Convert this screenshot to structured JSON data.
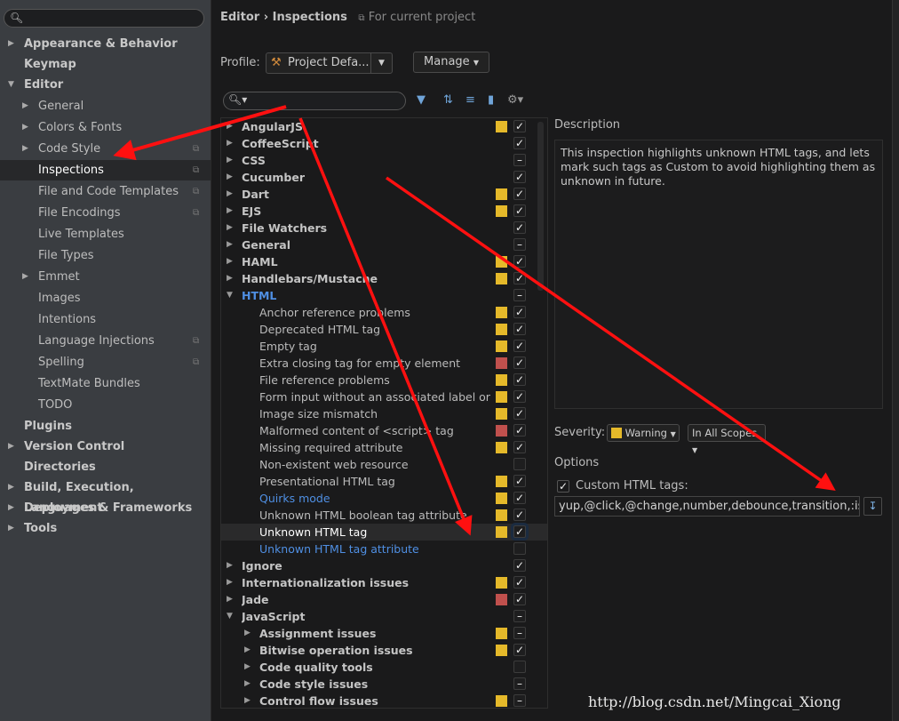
{
  "colors": {
    "warning": "#e5b92a",
    "error": "#c0504d",
    "link": "#4f8fe3",
    "accent": "#6fa4d8",
    "arrow": "#ff1010"
  },
  "sidebar": {
    "search_placeholder": "",
    "items": [
      {
        "label": "Appearance & Behavior",
        "level": 0,
        "arrow": "right"
      },
      {
        "label": "Keymap",
        "level": 0
      },
      {
        "label": "Editor",
        "level": 0,
        "arrow": "down"
      },
      {
        "label": "General",
        "level": 1,
        "arrow": "right"
      },
      {
        "label": "Colors & Fonts",
        "level": 1,
        "arrow": "right"
      },
      {
        "label": "Code Style",
        "level": 1,
        "arrow": "right",
        "copy": true
      },
      {
        "label": "Inspections",
        "level": 1,
        "selected": true,
        "copy": true
      },
      {
        "label": "File and Code Templates",
        "level": 1,
        "copy": true
      },
      {
        "label": "File Encodings",
        "level": 1,
        "copy": true
      },
      {
        "label": "Live Templates",
        "level": 1
      },
      {
        "label": "File Types",
        "level": 1
      },
      {
        "label": "Emmet",
        "level": 1,
        "arrow": "right"
      },
      {
        "label": "Images",
        "level": 1
      },
      {
        "label": "Intentions",
        "level": 1
      },
      {
        "label": "Language Injections",
        "level": 1,
        "copy": true
      },
      {
        "label": "Spelling",
        "level": 1,
        "copy": true
      },
      {
        "label": "TextMate Bundles",
        "level": 1
      },
      {
        "label": "TODO",
        "level": 1
      },
      {
        "label": "Plugins",
        "level": 0
      },
      {
        "label": "Version Control",
        "level": 0,
        "arrow": "right"
      },
      {
        "label": "Directories",
        "level": 0
      },
      {
        "label": "Build, Execution, Deployment",
        "level": 0,
        "arrow": "right"
      },
      {
        "label": "Languages & Frameworks",
        "level": 0,
        "arrow": "right"
      },
      {
        "label": "Tools",
        "level": 0,
        "arrow": "right"
      }
    ]
  },
  "header": {
    "crumb_parent": "Editor",
    "crumb_sep": "›",
    "crumb_current": "Inspections",
    "scope": "For current project"
  },
  "profile": {
    "label": "Profile:",
    "value": "Project Defa...",
    "manage": "Manage"
  },
  "tree": {
    "rows": [
      {
        "label": "AngularJS",
        "level": 0,
        "group": true,
        "arrow": "right",
        "sev": "warning",
        "check": "checked"
      },
      {
        "label": "CoffeeScript",
        "level": 0,
        "group": true,
        "arrow": "right",
        "sev": null,
        "check": "checked"
      },
      {
        "label": "CSS",
        "level": 0,
        "group": true,
        "arrow": "right",
        "sev": null,
        "check": "partial"
      },
      {
        "label": "Cucumber",
        "level": 0,
        "group": true,
        "arrow": "right",
        "sev": null,
        "check": "checked"
      },
      {
        "label": "Dart",
        "level": 0,
        "group": true,
        "arrow": "right",
        "sev": "warning",
        "check": "checked"
      },
      {
        "label": "EJS",
        "level": 0,
        "group": true,
        "arrow": "right",
        "sev": "warning",
        "check": "checked"
      },
      {
        "label": "File Watchers",
        "level": 0,
        "group": true,
        "arrow": "right",
        "sev": null,
        "check": "checked"
      },
      {
        "label": "General",
        "level": 0,
        "group": true,
        "arrow": "right",
        "sev": null,
        "check": "partial"
      },
      {
        "label": "HAML",
        "level": 0,
        "group": true,
        "arrow": "right",
        "sev": "warning",
        "check": "checked"
      },
      {
        "label": "Handlebars/Mustache",
        "level": 0,
        "group": true,
        "arrow": "right",
        "sev": "warning",
        "check": "checked"
      },
      {
        "label": "HTML",
        "level": 0,
        "group": true,
        "arrow": "down",
        "sev": null,
        "check": "partial",
        "blue": true
      },
      {
        "label": "Anchor reference problems",
        "level": 1,
        "sev": "warning",
        "check": "checked"
      },
      {
        "label": "Deprecated HTML tag",
        "level": 1,
        "sev": "warning",
        "check": "checked"
      },
      {
        "label": "Empty tag",
        "level": 1,
        "sev": "warning",
        "check": "checked"
      },
      {
        "label": "Extra closing tag for empty element",
        "level": 1,
        "sev": "error",
        "check": "checked"
      },
      {
        "label": "File reference problems",
        "level": 1,
        "sev": "warning",
        "check": "checked"
      },
      {
        "label": "Form input without an associated label or title",
        "level": 1,
        "sev": "warning",
        "check": "checked"
      },
      {
        "label": "Image size mismatch",
        "level": 1,
        "sev": "warning",
        "check": "checked"
      },
      {
        "label": "Malformed content of <script> tag",
        "level": 1,
        "sev": "error",
        "check": "checked"
      },
      {
        "label": "Missing required attribute",
        "level": 1,
        "sev": "warning",
        "check": "checked"
      },
      {
        "label": "Non-existent web resource",
        "level": 1,
        "sev": null,
        "check": "unchecked"
      },
      {
        "label": "Presentational HTML tag",
        "level": 1,
        "sev": "warning",
        "check": "checked"
      },
      {
        "label": "Quirks mode",
        "level": 1,
        "sev": "warning",
        "check": "checked",
        "blue": true
      },
      {
        "label": "Unknown HTML boolean tag attribute",
        "level": 1,
        "sev": "warning",
        "check": "checked"
      },
      {
        "label": "Unknown HTML tag",
        "level": 1,
        "sev": "warning",
        "check": "checked",
        "selected": true
      },
      {
        "label": "Unknown HTML tag attribute",
        "level": 1,
        "sev": null,
        "check": "unchecked",
        "blue": true
      },
      {
        "label": "Ignore",
        "level": 0,
        "group": true,
        "arrow": "right",
        "sev": null,
        "check": "checked"
      },
      {
        "label": "Internationalization issues",
        "level": 0,
        "group": true,
        "arrow": "right",
        "sev": "warning",
        "check": "checked"
      },
      {
        "label": "Jade",
        "level": 0,
        "group": true,
        "arrow": "right",
        "sev": "error",
        "check": "checked"
      },
      {
        "label": "JavaScript",
        "level": 0,
        "group": true,
        "arrow": "down",
        "sev": null,
        "check": "partial"
      },
      {
        "label": "Assignment issues",
        "level": 1,
        "group": true,
        "arrow": "right",
        "sev": "warning",
        "check": "partial"
      },
      {
        "label": "Bitwise operation issues",
        "level": 1,
        "group": true,
        "arrow": "right",
        "sev": "warning",
        "check": "checked"
      },
      {
        "label": "Code quality tools",
        "level": 1,
        "group": true,
        "arrow": "right",
        "sev": null,
        "check": "unchecked"
      },
      {
        "label": "Code style issues",
        "level": 1,
        "group": true,
        "arrow": "right",
        "sev": null,
        "check": "partial"
      },
      {
        "label": "Control flow issues",
        "level": 1,
        "group": true,
        "arrow": "right",
        "sev": "warning",
        "check": "partial"
      }
    ]
  },
  "description": {
    "label": "Description",
    "text": "This inspection highlights unknown HTML tags, and lets mark such tags as Custom to avoid highlighting them as unknown in future."
  },
  "severity": {
    "label": "Severity:",
    "value": "Warning",
    "scope": "In All Scopes"
  },
  "options": {
    "label": "Options",
    "custom_tags_label": "Custom HTML tags:",
    "custom_tags_checked": true,
    "custom_tags_value": "yup,@click,@change,number,debounce,transition,:is"
  },
  "watermark": "http://blog.csdn.net/Mingcai_Xiong"
}
